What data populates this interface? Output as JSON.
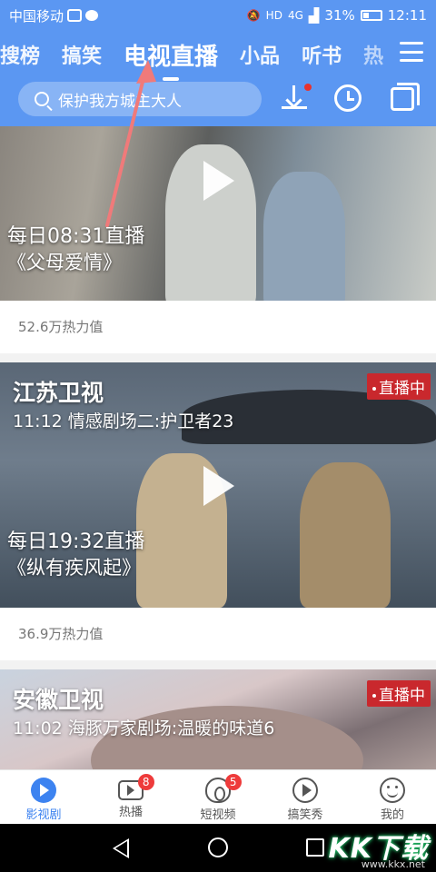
{
  "status_bar": {
    "carrier": "中国移动",
    "network": "4G",
    "hd": "HD",
    "battery": "31%",
    "time": "12:11"
  },
  "tabs": [
    {
      "label": "搜榜"
    },
    {
      "label": "搞笑"
    },
    {
      "label": "电视直播",
      "active": true
    },
    {
      "label": "小品"
    },
    {
      "label": "听书"
    },
    {
      "label": "热"
    }
  ],
  "search": {
    "placeholder": "保护我方城主大人"
  },
  "feed": [
    {
      "channel": "",
      "program": "",
      "live": false,
      "schedule": "每日08:31直播",
      "show": "《父母爱情》",
      "heat": "52.6万热力值"
    },
    {
      "channel": "江苏卫视",
      "program": "11:12 情感剧场二:护卫者23",
      "live": true,
      "live_label": "直播中",
      "schedule": "每日19:32直播",
      "show": "《纵有疾风起》",
      "heat": "36.9万热力值"
    },
    {
      "channel": "安徽卫视",
      "program": "11:02 海豚万家剧场:温暖的味道6",
      "live": true,
      "live_label": "直播中"
    }
  ],
  "bottom_nav": [
    {
      "label": "影视剧",
      "icon": "film-icon",
      "active": true
    },
    {
      "label": "热播",
      "icon": "video-icon",
      "badge": "8"
    },
    {
      "label": "短视频",
      "icon": "fire-icon",
      "badge": "5"
    },
    {
      "label": "搞笑秀",
      "icon": "play-icon"
    },
    {
      "label": "我的",
      "icon": "smile-icon"
    }
  ],
  "watermark": {
    "text": "KK下载",
    "url": "www.kkx.net"
  },
  "colors": {
    "header_blue": "#5b97f2",
    "accent_blue": "#3d83f0",
    "live_red": "#c9282d",
    "annotation_pink": "#f07a7a"
  }
}
